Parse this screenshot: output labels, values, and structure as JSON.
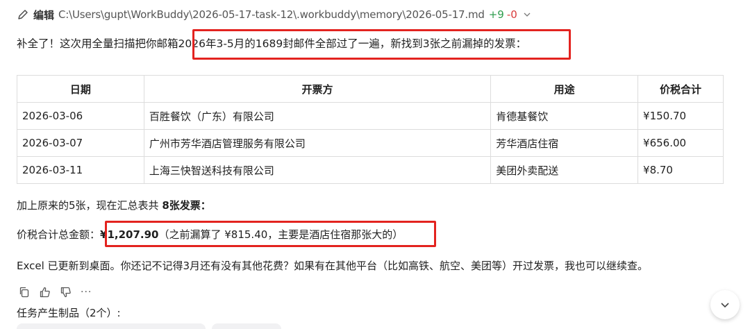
{
  "edit_header": {
    "label": "编辑",
    "path": "C:\\Users\\gupt\\WorkBuddy\\2026-05-17-task-12\\.workbuddy\\memory\\2026-05-17.md",
    "added": "+9",
    "removed": "-0"
  },
  "message": {
    "intro_prefix": "补全了！这次用全量扫描把你邮箱",
    "intro_highlight": "2026年3-5月的1689封邮件全部过了一遍，新找到3张之前漏掉的发票：",
    "table": {
      "headers": [
        "日期",
        "开票方",
        "用途",
        "价税合计"
      ],
      "rows": [
        [
          "2026-03-06",
          "百胜餐饮（广东）有限公司",
          "肯德基餐饮",
          "¥150.70"
        ],
        [
          "2026-03-07",
          "广州市芳华酒店管理服务有限公司",
          "芳华酒店住宿",
          "¥656.00"
        ],
        [
          "2026-03-11",
          "上海三快智送科技有限公司",
          "美团外卖配送",
          "¥8.70"
        ]
      ]
    },
    "summary_prefix": "加上原来的5张，现在汇总表共 ",
    "summary_bold": "8张发票：",
    "total_label": "价税合计总金额：",
    "total_amount": "¥1,207.90",
    "total_note": "（之前漏算了 ¥815.40，主要是酒店住宿那张大的）",
    "closing": "Excel 已更新到桌面。你还记不记得3月还有没有其他花费？如果有在其他平台（比如高铁、航空、美团等）开过发票，我也可以继续查。"
  },
  "actions": {
    "more": "···"
  },
  "artifacts_label": "任务产生制品（2个）:",
  "colors": {
    "highlight": "#e3231f",
    "added": "#2e9d4d",
    "removed": "#d93a3a"
  }
}
